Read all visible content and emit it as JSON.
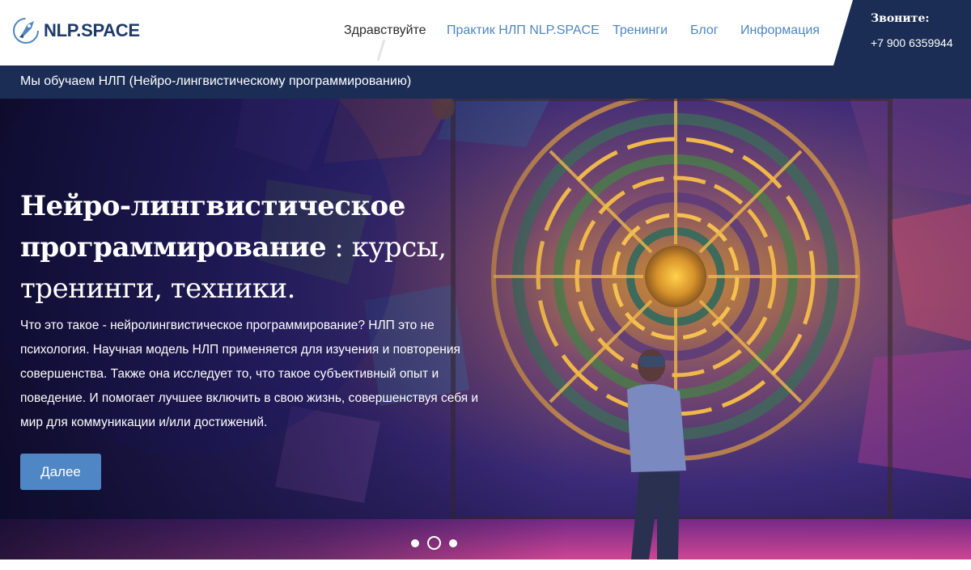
{
  "brand": {
    "name": "NLP.SPACE",
    "colors": {
      "primary": "#1e3a6b",
      "accent": "#4f86c1",
      "dark": "#1c2d55"
    }
  },
  "nav": {
    "items": [
      {
        "label": "Здравствуйте",
        "active": true
      },
      {
        "label": "Практик НЛП NLP.SPACE",
        "active": false
      },
      {
        "label": "Тренинги",
        "active": false
      },
      {
        "label": "Блог",
        "active": false
      },
      {
        "label": "Информация",
        "active": false
      }
    ]
  },
  "contact": {
    "label": "Звоните:",
    "phone": "+7 900 6359944"
  },
  "tagline": "Мы обучаем НЛП (Нейро-лингвистическому программированию)",
  "hero": {
    "title_bold_1": "Нейро-лингвистическое",
    "title_bold_2": "программирование",
    "title_light_1": " : курсы,",
    "title_light_2": "тренинги, техники.",
    "description": "Что это такое - нейролингвистическое программирование? НЛП это не психология. Научная модель НЛП применяется для изучения и повторения совершенства. Также она исследует то, что такое субъективный опыт и поведение. И помогает лучшее включить в свою жизнь, совершенствуя себя и мир для коммуникации и/или достижений.",
    "button_label": "Далее",
    "image_icon": "labyrinth-painting-image",
    "slides": {
      "count": 3,
      "active": 2
    }
  }
}
